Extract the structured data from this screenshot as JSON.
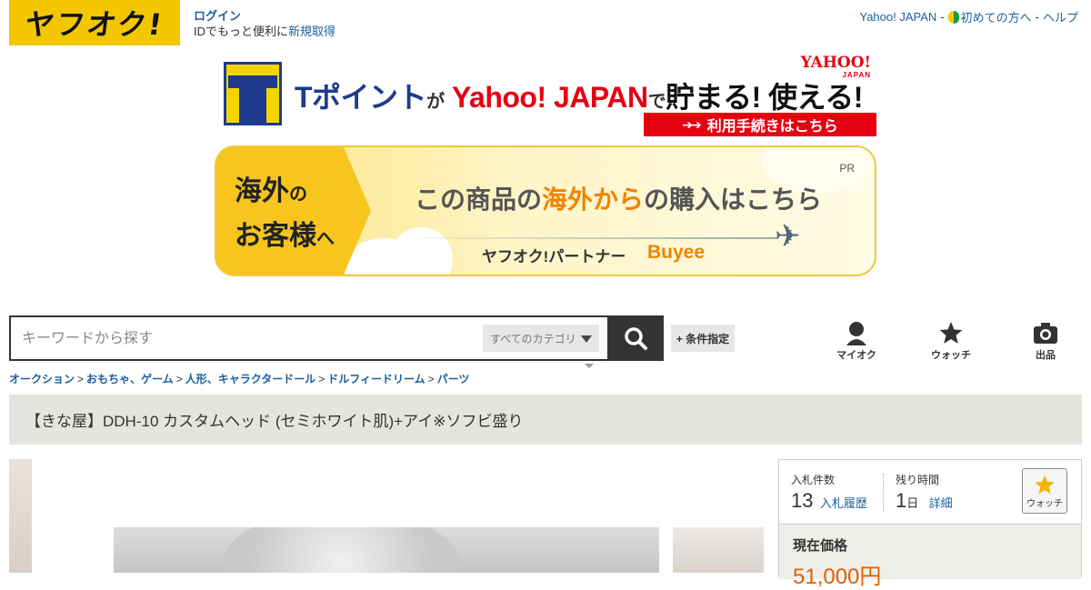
{
  "header": {
    "logo_text": "ヤフオク!",
    "login_label": "ログイン",
    "login_sub": "IDでもっと便利に",
    "register_link": "新規取得",
    "top_links": [
      {
        "label": "Yahoo! JAPAN"
      },
      {
        "label": "初めての方へ"
      },
      {
        "label": "ヘルプ"
      }
    ],
    "separator": "-"
  },
  "tpoint_banner": {
    "t_point": "Tポイント",
    "ga": "が",
    "yahoo_japan": "Yahoo! JAPAN",
    "de": "で",
    "save_use": "貯まる! 使える!",
    "logo_top": "YAHOO!",
    "logo_bottom": "JAPAN",
    "cta": "利用手続きはこちら",
    "cta_arrows": "➔➔"
  },
  "buyee_banner": {
    "left_line1": "海外",
    "left_line1_small": "の",
    "left_line2": "お客様",
    "left_line2_small": "へ",
    "headline_part1": "この商品の",
    "headline_highlight": "海外から",
    "headline_part2": "の購入はこちら",
    "partner": "ヤフオク!パートナー",
    "brand": "Buyee",
    "pr": "PR",
    "colors": {
      "accent": "#f7c51e",
      "highlight": "#f08300"
    }
  },
  "search": {
    "placeholder": "キーワードから探す",
    "category": "すべてのカテゴリ",
    "conditions": "+ 条件指定"
  },
  "nav": [
    {
      "label": "マイオク",
      "icon": "person-icon"
    },
    {
      "label": "ウォッチ",
      "icon": "star-icon"
    },
    {
      "label": "出品",
      "icon": "camera-icon"
    }
  ],
  "breadcrumb": [
    "オークション",
    "おもちゃ、ゲーム",
    "人形、キャラクタードール",
    "ドルフィードリーム",
    "パーツ"
  ],
  "item": {
    "title": "【きな屋】DDH-10 カスタムヘッド (セミホワイト肌)+アイ※ソフビ盛り"
  },
  "bid_panel": {
    "bids_label": "入札件数",
    "bids_count": "13",
    "bid_history_link": "入札履歴",
    "time_label": "残り時間",
    "time_value": "1",
    "time_unit": "日",
    "details_link": "詳細",
    "watch_label": "ウォッチ",
    "current_price_label": "現在価格",
    "current_price": "51,000円"
  }
}
